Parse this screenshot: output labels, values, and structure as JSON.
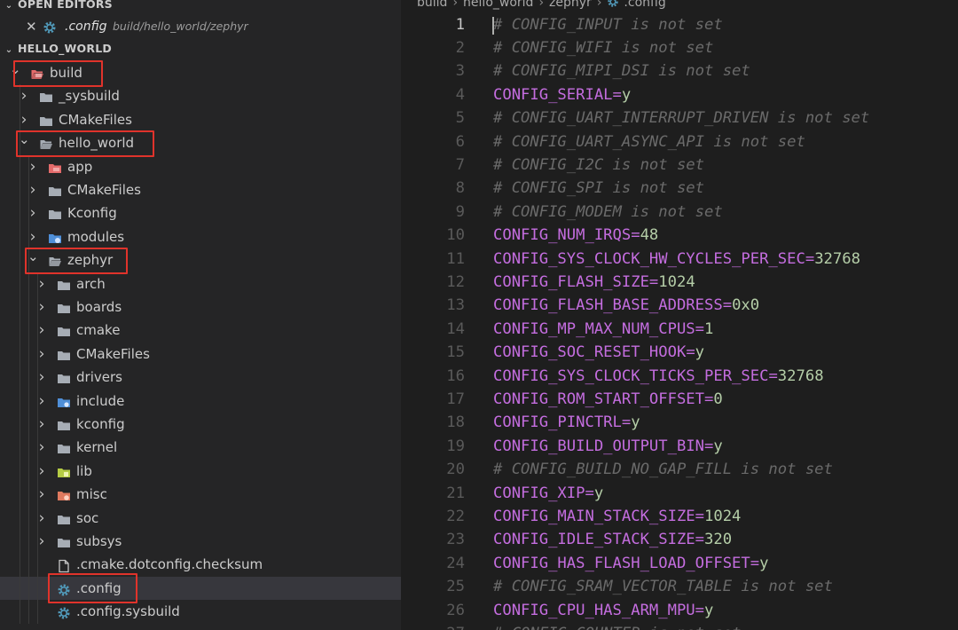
{
  "sidebar": {
    "open_editors_title": "OPEN EDITORS",
    "open_editor": {
      "name": ".config",
      "path": "build/hello_world/zephyr"
    },
    "workspace_title": "HELLO_WORLD",
    "tree": [
      {
        "label": "build",
        "depth": 0,
        "expanded": true,
        "icon": "folder-build-icon"
      },
      {
        "label": "_sysbuild",
        "depth": 1,
        "expanded": false,
        "icon": "folder-icon"
      },
      {
        "label": "CMakeFiles",
        "depth": 1,
        "expanded": false,
        "icon": "folder-icon"
      },
      {
        "label": "hello_world",
        "depth": 1,
        "expanded": true,
        "icon": "folder-open-icon"
      },
      {
        "label": "app",
        "depth": 2,
        "expanded": false,
        "icon": "folder-app-icon"
      },
      {
        "label": "CMakeFiles",
        "depth": 2,
        "expanded": false,
        "icon": "folder-icon"
      },
      {
        "label": "Kconfig",
        "depth": 2,
        "expanded": false,
        "icon": "folder-icon"
      },
      {
        "label": "modules",
        "depth": 2,
        "expanded": false,
        "icon": "folder-modules-icon"
      },
      {
        "label": "zephyr",
        "depth": 2,
        "expanded": true,
        "icon": "folder-open-icon"
      },
      {
        "label": "arch",
        "depth": 3,
        "expanded": false,
        "icon": "folder-icon"
      },
      {
        "label": "boards",
        "depth": 3,
        "expanded": false,
        "icon": "folder-icon"
      },
      {
        "label": "cmake",
        "depth": 3,
        "expanded": false,
        "icon": "folder-icon"
      },
      {
        "label": "CMakeFiles",
        "depth": 3,
        "expanded": false,
        "icon": "folder-icon"
      },
      {
        "label": "drivers",
        "depth": 3,
        "expanded": false,
        "icon": "folder-icon"
      },
      {
        "label": "include",
        "depth": 3,
        "expanded": false,
        "icon": "folder-include-icon"
      },
      {
        "label": "kconfig",
        "depth": 3,
        "expanded": false,
        "icon": "folder-icon"
      },
      {
        "label": "kernel",
        "depth": 3,
        "expanded": false,
        "icon": "folder-icon"
      },
      {
        "label": "lib",
        "depth": 3,
        "expanded": false,
        "icon": "folder-lib-icon"
      },
      {
        "label": "misc",
        "depth": 3,
        "expanded": false,
        "icon": "folder-misc-icon"
      },
      {
        "label": "soc",
        "depth": 3,
        "expanded": false,
        "icon": "folder-icon"
      },
      {
        "label": "subsys",
        "depth": 3,
        "expanded": false,
        "icon": "folder-icon"
      },
      {
        "label": ".cmake.dotconfig.checksum",
        "depth": 3,
        "file": true,
        "icon": "file-icon"
      },
      {
        "label": ".config",
        "depth": 3,
        "file": true,
        "icon": "gear-icon",
        "selected": true
      },
      {
        "label": ".config.sysbuild",
        "depth": 3,
        "file": true,
        "icon": "gear-icon"
      }
    ]
  },
  "editor": {
    "breadcrumb": [
      "build",
      "hello_world",
      "zephyr",
      ".config"
    ],
    "lines": [
      {
        "n": "1",
        "type": "comment",
        "text": "# CONFIG_INPUT is not set"
      },
      {
        "n": "2",
        "type": "comment",
        "text": "# CONFIG_WIFI is not set"
      },
      {
        "n": "3",
        "type": "comment",
        "text": "# CONFIG_MIPI_DSI is not set"
      },
      {
        "n": "4",
        "type": "kv",
        "key": "CONFIG_SERIAL",
        "val": "y"
      },
      {
        "n": "5",
        "type": "comment",
        "text": "# CONFIG_UART_INTERRUPT_DRIVEN is not set"
      },
      {
        "n": "6",
        "type": "comment",
        "text": "# CONFIG_UART_ASYNC_API is not set"
      },
      {
        "n": "7",
        "type": "comment",
        "text": "# CONFIG_I2C is not set"
      },
      {
        "n": "8",
        "type": "comment",
        "text": "# CONFIG_SPI is not set"
      },
      {
        "n": "9",
        "type": "comment",
        "text": "# CONFIG_MODEM is not set"
      },
      {
        "n": "10",
        "type": "kv",
        "key": "CONFIG_NUM_IRQS",
        "val": "48"
      },
      {
        "n": "11",
        "type": "kv",
        "key": "CONFIG_SYS_CLOCK_HW_CYCLES_PER_SEC",
        "val": "32768"
      },
      {
        "n": "12",
        "type": "kv",
        "key": "CONFIG_FLASH_SIZE",
        "val": "1024"
      },
      {
        "n": "13",
        "type": "kv",
        "key": "CONFIG_FLASH_BASE_ADDRESS",
        "val": "0x0"
      },
      {
        "n": "14",
        "type": "kv",
        "key": "CONFIG_MP_MAX_NUM_CPUS",
        "val": "1"
      },
      {
        "n": "15",
        "type": "kv",
        "key": "CONFIG_SOC_RESET_HOOK",
        "val": "y"
      },
      {
        "n": "16",
        "type": "kv",
        "key": "CONFIG_SYS_CLOCK_TICKS_PER_SEC",
        "val": "32768"
      },
      {
        "n": "17",
        "type": "kv",
        "key": "CONFIG_ROM_START_OFFSET",
        "val": "0"
      },
      {
        "n": "18",
        "type": "kv",
        "key": "CONFIG_PINCTRL",
        "val": "y"
      },
      {
        "n": "19",
        "type": "kv",
        "key": "CONFIG_BUILD_OUTPUT_BIN",
        "val": "y"
      },
      {
        "n": "20",
        "type": "comment",
        "text": "# CONFIG_BUILD_NO_GAP_FILL is not set"
      },
      {
        "n": "21",
        "type": "kv",
        "key": "CONFIG_XIP",
        "val": "y"
      },
      {
        "n": "22",
        "type": "kv",
        "key": "CONFIG_MAIN_STACK_SIZE",
        "val": "1024"
      },
      {
        "n": "23",
        "type": "kv",
        "key": "CONFIG_IDLE_STACK_SIZE",
        "val": "320"
      },
      {
        "n": "24",
        "type": "kv",
        "key": "CONFIG_HAS_FLASH_LOAD_OFFSET",
        "val": "y"
      },
      {
        "n": "25",
        "type": "comment",
        "text": "# CONFIG_SRAM_VECTOR_TABLE is not set"
      },
      {
        "n": "26",
        "type": "kv",
        "key": "CONFIG_CPU_HAS_ARM_MPU",
        "val": "y"
      },
      {
        "n": "27",
        "type": "comment",
        "text": "# CONFIG_COUNTER is not set"
      }
    ]
  },
  "colors": {
    "highlight_box": "#e0332b",
    "key": "#c46ddf",
    "value": "#b5cea8",
    "comment": "#6a6a6a"
  }
}
